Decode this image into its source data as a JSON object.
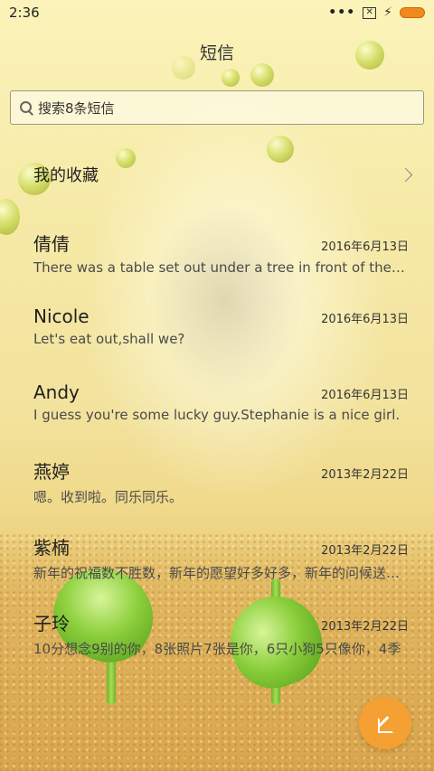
{
  "status_bar": {
    "time": "2:36",
    "dots": "•••",
    "sim_icon": "no-sim-icon",
    "charging_icon": "bolt-icon",
    "battery_color": "#f08a1e"
  },
  "title": "短信",
  "search": {
    "placeholder": "搜索8条短信"
  },
  "favorites": {
    "label": "我的收藏"
  },
  "conversations": [
    {
      "name": "倩倩",
      "date": "2016年6月13日",
      "snippet": "There was a table set out under a tree in front of the house"
    },
    {
      "name": "Nicole",
      "date": "2016年6月13日",
      "snippet": "Let's eat out,shall we?"
    },
    {
      "name": "Andy",
      "date": "2016年6月13日",
      "snippet": "I guess you're some lucky guy.Stephanie is a nice girl."
    },
    {
      "name": "燕婷",
      "date": "2013年2月22日",
      "snippet": "嗯。收到啦。同乐同乐。"
    },
    {
      "name": "紫楠",
      "date": "2013年2月22日",
      "snippet": "新年的祝福数不胜数，新年的愿望好多好多，新年的问候送给你"
    },
    {
      "name": "子玲",
      "date": "2013年2月22日",
      "snippet": "10分想念9别的你，8张照片7张是你，6只小狗5只像你，4季"
    }
  ],
  "fab": {
    "icon": "compose-icon",
    "color": "#f5a033"
  }
}
